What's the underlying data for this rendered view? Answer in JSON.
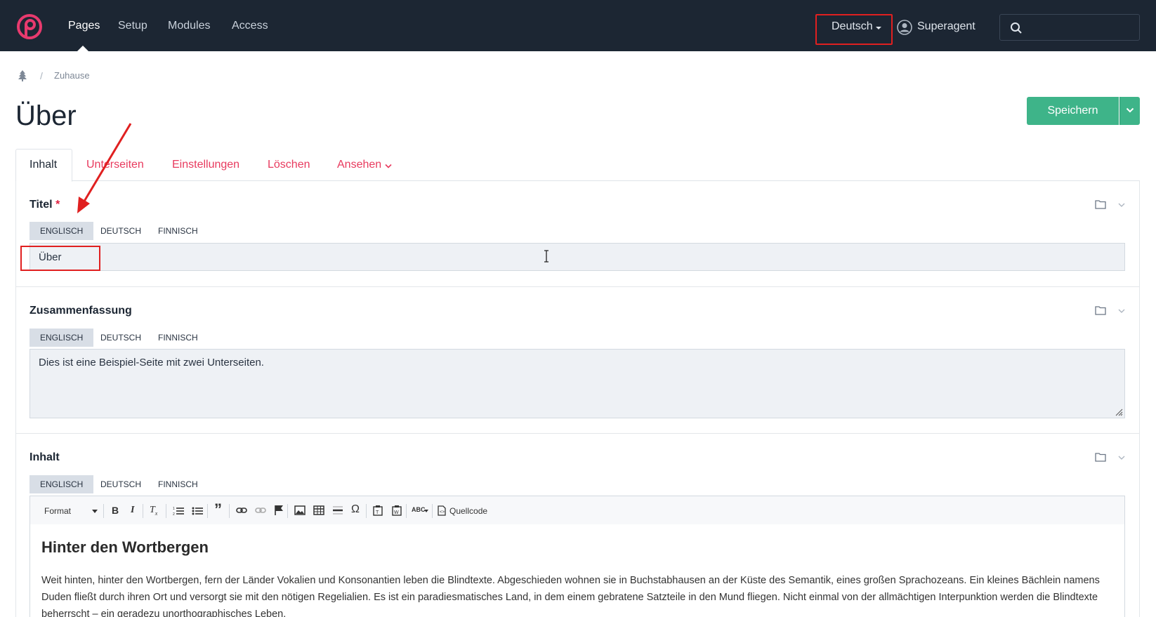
{
  "nav": {
    "items": [
      "Pages",
      "Setup",
      "Modules",
      "Access"
    ],
    "language": "Deutsch",
    "user": "Superagent",
    "search_placeholder": ""
  },
  "breadcrumb": {
    "home": "Zuhause"
  },
  "page": {
    "title": "Über",
    "save_label": "Speichern"
  },
  "tabs": [
    "Inhalt",
    "Unterseiten",
    "Einstellungen",
    "Löschen",
    "Ansehen"
  ],
  "fields": {
    "titel": {
      "label": "Titel",
      "required_mark": "*",
      "langs": [
        "ENGLISCH",
        "DEUTSCH",
        "FINNISCH"
      ],
      "value": "Über"
    },
    "zusammenfassung": {
      "label": "Zusammenfassung",
      "langs": [
        "ENGLISCH",
        "DEUTSCH",
        "FINNISCH"
      ],
      "value": "Dies ist eine Beispiel-Seite mit zwei Unterseiten."
    },
    "inhalt": {
      "label": "Inhalt",
      "langs": [
        "ENGLISCH",
        "DEUTSCH",
        "FINNISCH"
      ],
      "toolbar": {
        "format": "Format",
        "source": "Quellcode"
      },
      "heading": "Hinter den Wortbergen",
      "paragraph": "Weit hinten, hinter den Wortbergen, fern der Länder Vokalien und Konsonantien leben die Blindtexte. Abgeschieden wohnen sie in Buchstabhausen an der Küste des Semantik, eines großen Sprachozeans. Ein kleines Bächlein namens Duden fließt durch ihren Ort und versorgt sie mit den nötigen Regelialien. Es ist ein paradiesmatisches Land, in dem einem gebratene Satzteile in den Mund fliegen. Nicht einmal von der allmächtigen Interpunktion werden die Blindtexte beherrscht – ein geradezu unorthographisches Leben."
    }
  },
  "colors": {
    "topbar": "#1c2633",
    "accent_tab": "#e83a5e",
    "save": "#3eb489",
    "annotation": "#e02020"
  }
}
